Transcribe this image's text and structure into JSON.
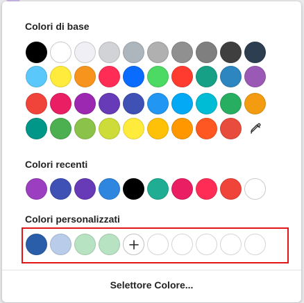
{
  "base_section": {
    "title": "Colori di base",
    "rows": [
      [
        "#000000",
        "#ffffff",
        "#efeff5",
        "#d2d3d7",
        "#adb5bd",
        "#b0b0b0",
        "#909090",
        "#7f7f7f",
        "#3f3f3f",
        "#2c3e50"
      ],
      [
        "#5ac8fa",
        "#ffeb3b",
        "#f7941d",
        "#ff2d55",
        "#0a6cff",
        "#4cd964",
        "#ff3b30",
        "#16a085",
        "#2e86c1",
        "#9b59b6"
      ],
      [
        "#f0443a",
        "#e91e63",
        "#9c27b0",
        "#673ab7",
        "#3f51b5",
        "#2196f3",
        "#03a9f4",
        "#00bcd4",
        "#27ae60",
        "#f39c12"
      ],
      [
        "#009688",
        "#4caf50",
        "#8bc34a",
        "#cddc39",
        "#ffeb3b",
        "#ffc107",
        "#ff9800",
        "#ff5722",
        "#e74c3c"
      ]
    ],
    "eyedropper_icon": "eyedropper-icon"
  },
  "recent_section": {
    "title": "Colori recenti",
    "colors": [
      "#9b3fc0",
      "#3f51b5",
      "#673ab7",
      "#2e86de",
      "#000000",
      "#1fae93",
      "#e91e63",
      "#ff2d55",
      "#f0443a",
      "#ffffff"
    ]
  },
  "custom_section": {
    "title": "Colori personalizzati",
    "colors": [
      "#2a5ea8",
      "#b9cdea",
      "#b8e3c2",
      "#b8e3c2"
    ],
    "add_icon": "plus-icon",
    "empty_slots": 5,
    "highlight_color": "#e11515"
  },
  "footer": {
    "picker_label": "Selettore Colore..."
  }
}
